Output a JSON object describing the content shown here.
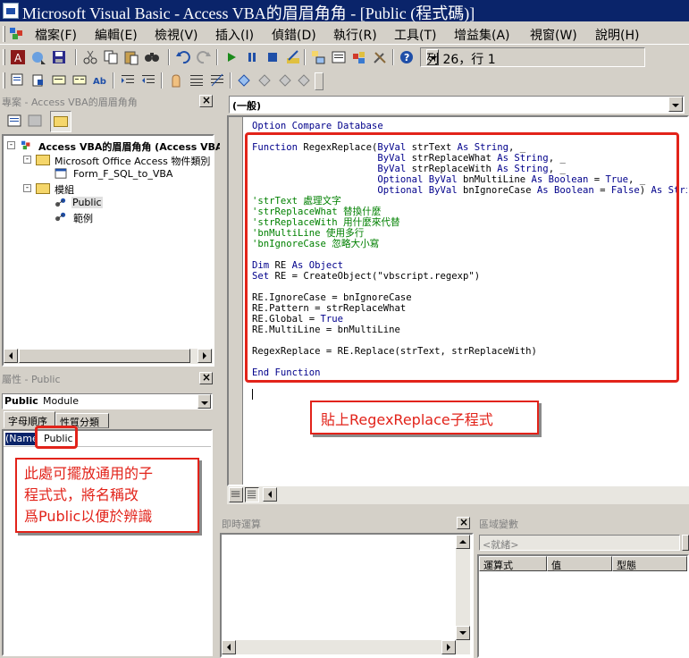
{
  "window": {
    "title": "Microsoft Visual Basic - Access VBA的眉眉角角 - [Public (程式碼)]"
  },
  "menu": {
    "items": [
      {
        "label": "檔案(F)"
      },
      {
        "label": "編輯(E)"
      },
      {
        "label": "檢視(V)"
      },
      {
        "label": "插入(I)"
      },
      {
        "label": "偵錯(D)"
      },
      {
        "label": "執行(R)"
      },
      {
        "label": "工具(T)"
      },
      {
        "label": "增益集(A)"
      },
      {
        "label": "視窗(W)"
      },
      {
        "label": "說明(H)"
      }
    ]
  },
  "toolbar": {
    "position": "列 26，行 1"
  },
  "project_pane": {
    "title": "專案 - Access VBA的眉眉角角",
    "root": "Access VBA的眉眉角角 (Access VBA",
    "group_objects": "Microsoft Office Access 物件類別",
    "form_item": "Form_F_SQL_to_VBA",
    "group_modules": "模組",
    "module_public": "Public",
    "module_example": "範例"
  },
  "properties_pane": {
    "title": "屬性 - Public",
    "object_name": "Public",
    "object_type": "Module",
    "tab_alpha": "字母順序",
    "tab_category": "性質分類",
    "prop_name": "(Name)",
    "prop_value": "Public"
  },
  "code_pane": {
    "proc_combo": "(一般)",
    "lines": [
      [
        {
          "t": "Option Compare Database",
          "c": "kw"
        }
      ],
      [
        {
          "t": "",
          "c": "tx"
        }
      ],
      [
        {
          "t": "Function ",
          "c": "kw"
        },
        {
          "t": "RegexReplace(",
          "c": "tx"
        },
        {
          "t": "ByVal ",
          "c": "kw"
        },
        {
          "t": "strText ",
          "c": "tx"
        },
        {
          "t": "As String",
          "c": "kw"
        },
        {
          "t": ", _",
          "c": "tx"
        }
      ],
      [
        {
          "t": "                      ",
          "c": "tx"
        },
        {
          "t": "ByVal ",
          "c": "kw"
        },
        {
          "t": "strReplaceWhat ",
          "c": "tx"
        },
        {
          "t": "As String",
          "c": "kw"
        },
        {
          "t": ", _",
          "c": "tx"
        }
      ],
      [
        {
          "t": "                      ",
          "c": "tx"
        },
        {
          "t": "ByVal ",
          "c": "kw"
        },
        {
          "t": "strReplaceWith ",
          "c": "tx"
        },
        {
          "t": "As String",
          "c": "kw"
        },
        {
          "t": ", _",
          "c": "tx"
        }
      ],
      [
        {
          "t": "                      ",
          "c": "tx"
        },
        {
          "t": "Optional ByVal ",
          "c": "kw"
        },
        {
          "t": "bnMultiLine ",
          "c": "tx"
        },
        {
          "t": "As Boolean",
          "c": "kw"
        },
        {
          "t": " = ",
          "c": "tx"
        },
        {
          "t": "True",
          "c": "kw"
        },
        {
          "t": ", _",
          "c": "tx"
        }
      ],
      [
        {
          "t": "                      ",
          "c": "tx"
        },
        {
          "t": "Optional ByVal ",
          "c": "kw"
        },
        {
          "t": "bnIgnoreCase ",
          "c": "tx"
        },
        {
          "t": "As Boolean",
          "c": "kw"
        },
        {
          "t": " = ",
          "c": "tx"
        },
        {
          "t": "False",
          "c": "kw"
        },
        {
          "t": ") ",
          "c": "tx"
        },
        {
          "t": "As String",
          "c": "kw"
        }
      ],
      [
        {
          "t": "'strText 處理文字",
          "c": "cm"
        }
      ],
      [
        {
          "t": "'strReplaceWhat 替換什麼",
          "c": "cm"
        }
      ],
      [
        {
          "t": "'strReplaceWith 用什麼來代替",
          "c": "cm"
        }
      ],
      [
        {
          "t": "'bnMultiLine 使用多行",
          "c": "cm"
        }
      ],
      [
        {
          "t": "'bnIgnoreCase 忽略大小寫",
          "c": "cm"
        }
      ],
      [
        {
          "t": "",
          "c": "tx"
        }
      ],
      [
        {
          "t": "Dim ",
          "c": "kw"
        },
        {
          "t": "RE ",
          "c": "tx"
        },
        {
          "t": "As Object",
          "c": "kw"
        }
      ],
      [
        {
          "t": "Set ",
          "c": "kw"
        },
        {
          "t": "RE = CreateObject(\"vbscript.regexp\")",
          "c": "tx"
        }
      ],
      [
        {
          "t": "",
          "c": "tx"
        }
      ],
      [
        {
          "t": "RE.IgnoreCase = bnIgnoreCase",
          "c": "tx"
        }
      ],
      [
        {
          "t": "RE.Pattern = strReplaceWhat",
          "c": "tx"
        }
      ],
      [
        {
          "t": "RE.Global = ",
          "c": "tx"
        },
        {
          "t": "True",
          "c": "kw"
        }
      ],
      [
        {
          "t": "RE.MultiLine = bnMultiLine",
          "c": "tx"
        }
      ],
      [
        {
          "t": "",
          "c": "tx"
        }
      ],
      [
        {
          "t": "RegexReplace = RE.Replace(strText, strReplaceWith)",
          "c": "tx"
        }
      ],
      [
        {
          "t": "",
          "c": "tx"
        }
      ],
      [
        {
          "t": "End Function",
          "c": "kw"
        }
      ]
    ]
  },
  "annotations": {
    "code_callout": "貼上RegexReplace子程式",
    "name_callout": "此處可擺放通用的子\n程式式，將名稱改\n爲Public以便於辨識"
  },
  "immediate_pane": {
    "title": "即時運算"
  },
  "locals_pane": {
    "title": "區域變數",
    "status": "<就緒>",
    "col_expression": "運算式",
    "col_value": "值",
    "col_type": "型態"
  },
  "colors": {
    "keyword": "#00008b",
    "comment": "#008000",
    "callout": "#e2231a",
    "titlebar": "#0a246a"
  }
}
